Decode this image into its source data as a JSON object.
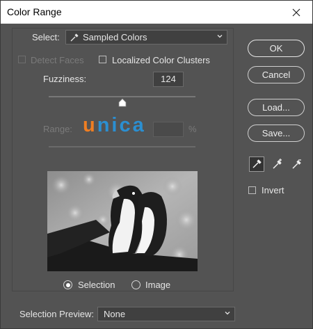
{
  "window": {
    "title": "Color Range"
  },
  "select": {
    "label": "Select:",
    "value": "Sampled Colors"
  },
  "options": {
    "detect_faces": "Detect Faces",
    "localized": "Localized Color Clusters"
  },
  "fuzziness": {
    "label": "Fuzziness:",
    "value": "124",
    "level": 0.5
  },
  "range": {
    "label": "Range:",
    "unit": "%",
    "value": ""
  },
  "watermark": {
    "text": "unica"
  },
  "preview": {
    "selection": "Selection",
    "image": "Image"
  },
  "selection_preview": {
    "label": "Selection Preview:",
    "value": "None"
  },
  "buttons": {
    "ok": "OK",
    "cancel": "Cancel",
    "load": "Load...",
    "save": "Save..."
  },
  "invert": {
    "label": "Invert"
  },
  "colors": {
    "dialog_bg": "#535353",
    "field_bg": "#404040",
    "text": "#e6e6e6",
    "disabled_text": "#7a7a7a",
    "logo_orange": "#ef7e22",
    "logo_blue": "#2b8fd1"
  }
}
